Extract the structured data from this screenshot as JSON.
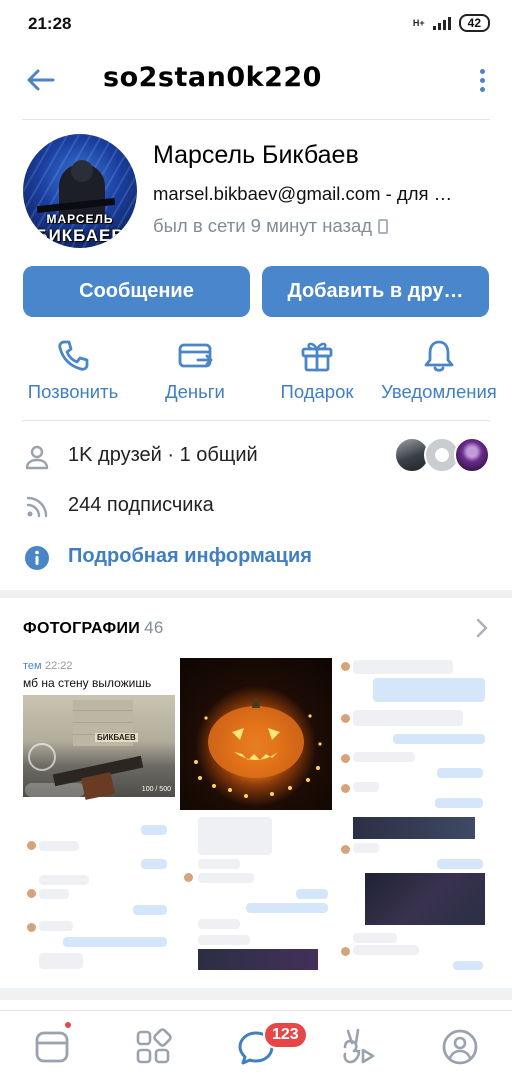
{
  "status_bar": {
    "time": "21:28",
    "network": "H+",
    "battery": "42"
  },
  "header": {
    "title": "so2stan0k220"
  },
  "profile": {
    "name": "Марсель Бикбаев",
    "status": "marsel.bikbaev@gmail.com - для …",
    "online": "был в сети 9 минут назад",
    "avatar_text_top": "МАРСЕЛЬ",
    "avatar_text_bottom": "БИКБАЕВ"
  },
  "buttons": {
    "message": "Сообщение",
    "add_friend": "Добавить в дру…"
  },
  "actions": [
    {
      "label": "Позвонить",
      "icon": "phone-icon"
    },
    {
      "label": "Деньги",
      "icon": "money-icon"
    },
    {
      "label": "Подарок",
      "icon": "gift-icon"
    },
    {
      "label": "Уведомления",
      "icon": "bell-icon"
    }
  ],
  "info": {
    "friends": "1K друзей · 1 общий",
    "followers": "244 подписчика",
    "details": "Подробная информация"
  },
  "photos": {
    "title": "ФОТОГРАФИИ",
    "count": "46",
    "p1_time": "22:22",
    "p1_name": "тем",
    "p1_text": "мб на стену выложишь",
    "p1_sign": "БИКБАЕВ",
    "p1_ammo": "100 / 500"
  },
  "nav": {
    "messages_badge": "123"
  },
  "colors": {
    "accent": "#4986cc",
    "link": "#3f7fc2",
    "badge": "#e64646",
    "muted": "#818c99"
  }
}
